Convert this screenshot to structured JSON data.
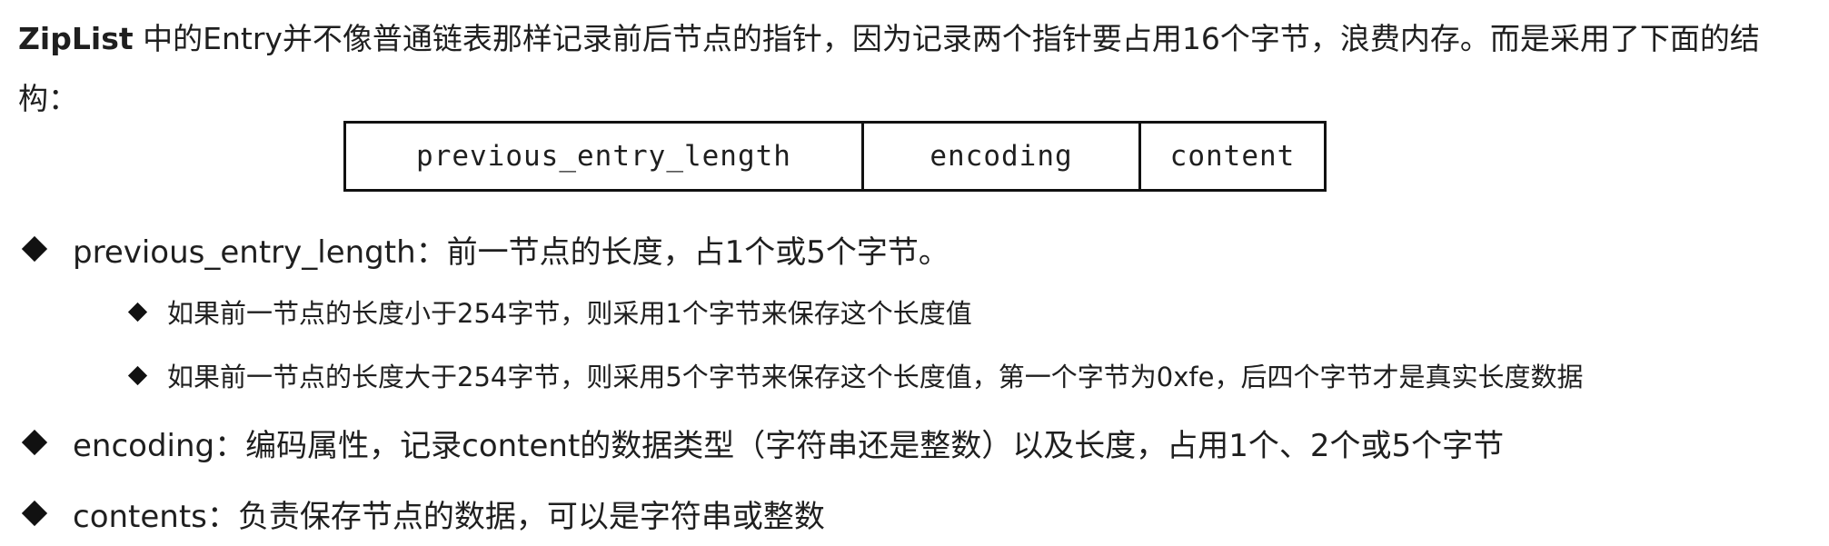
{
  "intro": {
    "bold": "ZipList",
    "text": " 中的Entry并不像普通链表那样记录前后节点的指针，因为记录两个指针要占用16个字节，浪费内存。而是采用了下面的结构："
  },
  "entry_table": [
    "previous_entry_length",
    "encoding",
    "content"
  ],
  "bullets": [
    {
      "text": "previous_entry_length：前一节点的长度，占1个或5个字节。"
    },
    {
      "text": "如果前一节点的长度小于254字节，则采用1个字节来保存这个长度值"
    },
    {
      "text": "如果前一节点的长度大于254字节，则采用5个字节来保存这个长度值，第一个字节为0xfe，后四个字节才是真实长度数据"
    },
    {
      "text": "encoding：编码属性，记录content的数据类型（字符串还是整数）以及长度，占用1个、2个或5个字节"
    },
    {
      "text": "contents：负责保存节点的数据，可以是字符串或整数"
    }
  ]
}
